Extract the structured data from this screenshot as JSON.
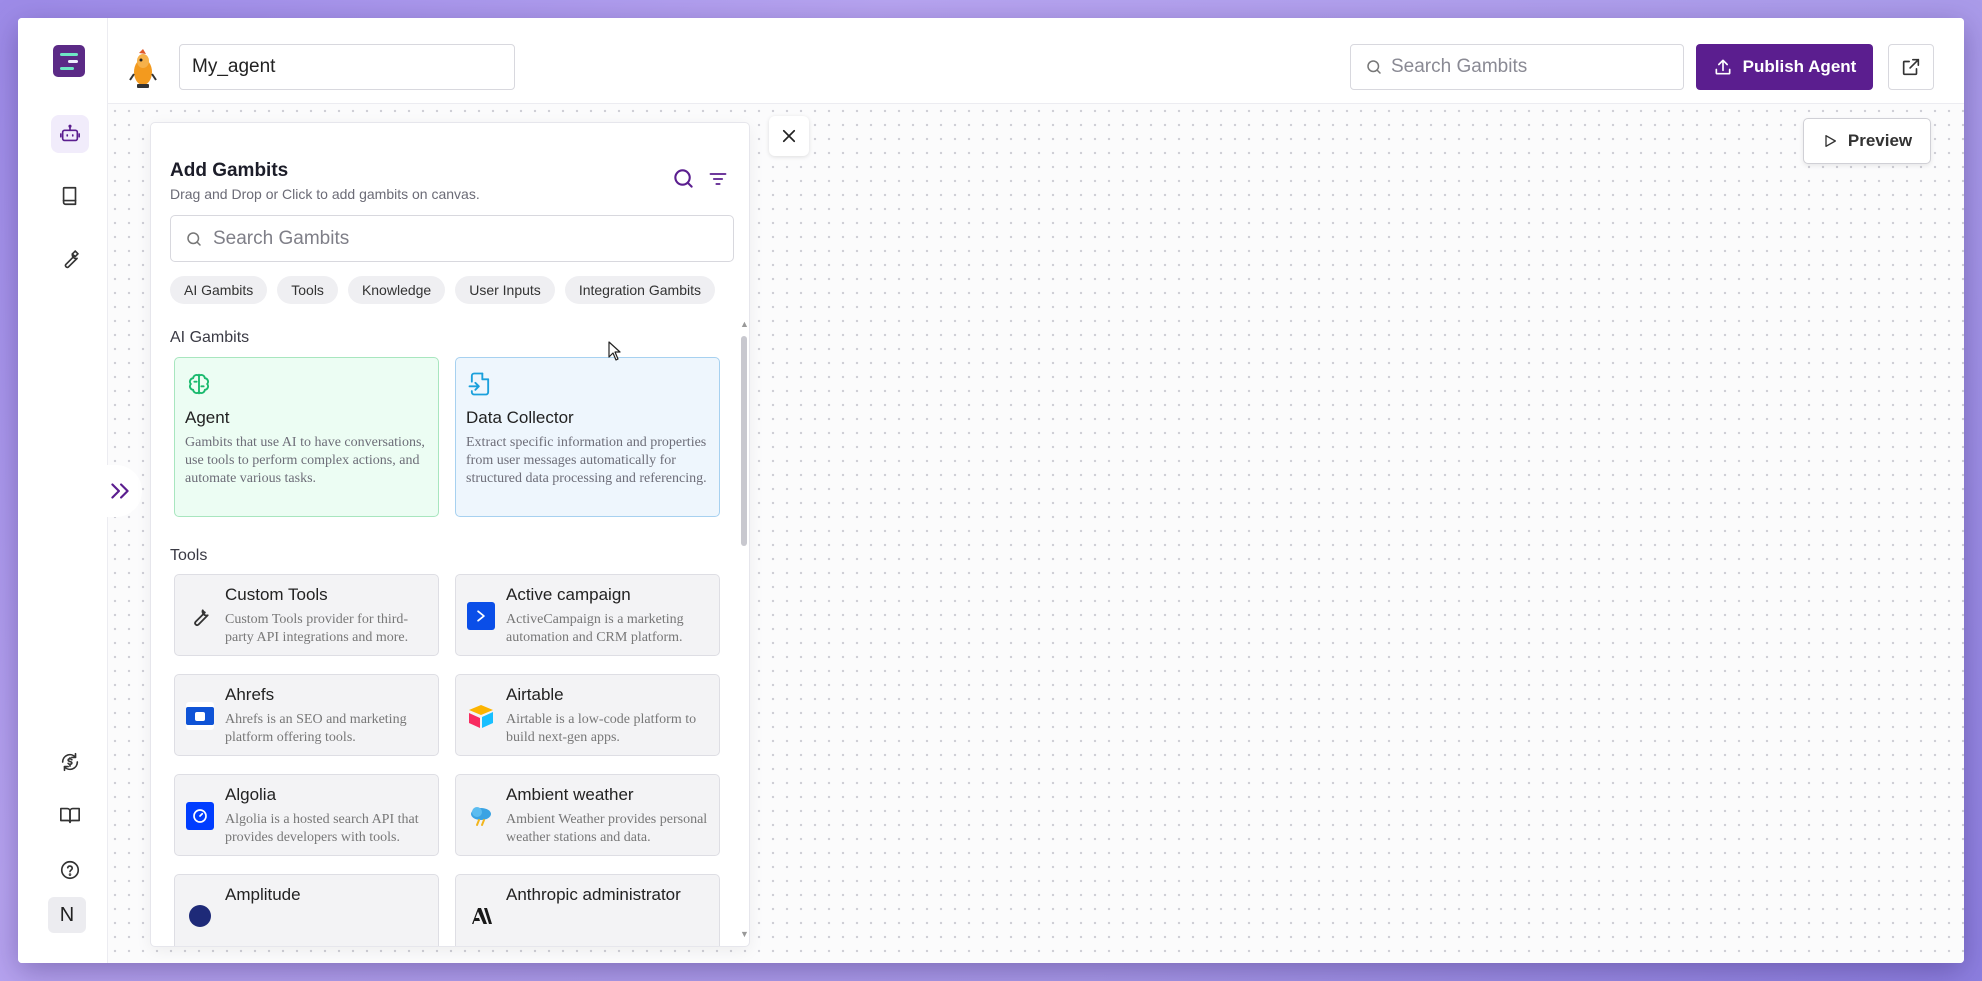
{
  "header": {
    "agent_name": "My_agent",
    "search_placeholder": "Search Gambits",
    "publish_label": "Publish Agent"
  },
  "canvas": {
    "preview_label": "Preview"
  },
  "rail": {
    "avatar_initial": "N"
  },
  "panel": {
    "title": "Add Gambits",
    "subtitle": "Drag and Drop or Click to add gambits on canvas.",
    "search_placeholder": "Search Gambits",
    "chips": [
      "AI Gambits",
      "Tools",
      "Knowledge",
      "User Inputs",
      "Integration Gambits"
    ],
    "ai_section_title": "AI Gambits",
    "ai_cards": [
      {
        "title": "Agent",
        "description": "Gambits that use AI to have conversations, use tools to perform complex actions, and automate various tasks.",
        "icon": "brain-icon"
      },
      {
        "title": "Data Collector",
        "description": "Extract specific information and properties from user messages automatically for structured data processing and referencing.",
        "icon": "file-import-icon"
      }
    ],
    "tools_section_title": "Tools",
    "tools": [
      {
        "title": "Custom Tools",
        "description": "Custom Tools provider for third-party API integrations and more.",
        "icon": "wrench-icon"
      },
      {
        "title": "Active campaign",
        "description": "ActiveCampaign is a marketing automation and CRM platform.",
        "icon": "activecampaign-icon"
      },
      {
        "title": "Ahrefs",
        "description": "Ahrefs is an SEO and marketing platform offering tools.",
        "icon": "ahrefs-icon"
      },
      {
        "title": "Airtable",
        "description": "Airtable is a low-code platform to build next-gen apps.",
        "icon": "airtable-icon"
      },
      {
        "title": "Algolia",
        "description": "Algolia is a hosted search API that provides developers with tools.",
        "icon": "algolia-icon"
      },
      {
        "title": "Ambient weather",
        "description": "Ambient Weather provides personal weather stations and data.",
        "icon": "ambient-weather-icon"
      },
      {
        "title": "Amplitude",
        "description": "",
        "icon": "amplitude-icon"
      },
      {
        "title": "Anthropic administrator",
        "description": "",
        "icon": "anthropic-icon"
      }
    ]
  },
  "colors": {
    "brand": "#5b1e8f",
    "agent_card_bg": "#ecfdf3",
    "collector_card_bg": "#eef6fd"
  }
}
